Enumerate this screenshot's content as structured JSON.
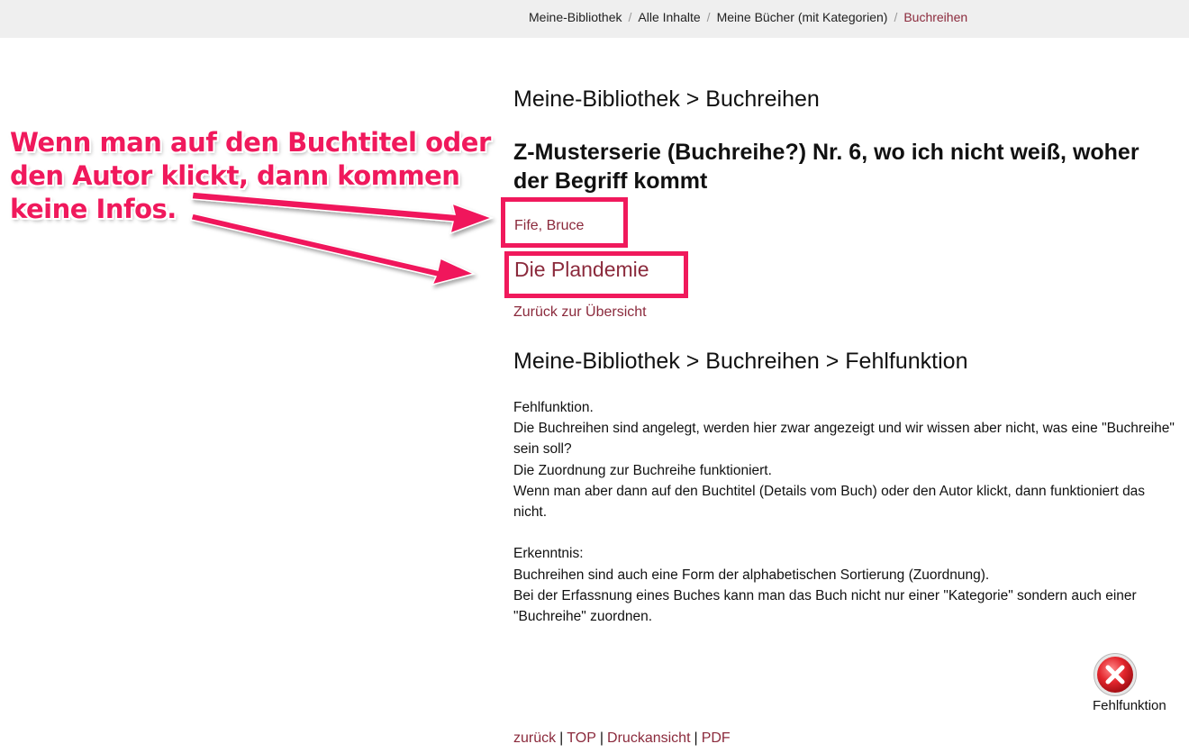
{
  "breadcrumb": {
    "items": [
      "Meine-Bibliothek",
      "Alle Inhalte",
      "Meine Bücher (mit Kategorien)"
    ],
    "current": "Buchreihen",
    "separator": "/"
  },
  "section1": {
    "heading": "Meine-Bibliothek > Buchreihen",
    "series_title": "Z-Musterserie (Buchreihe?) Nr. 6, wo ich nicht weiß, woher der Begriff kommt",
    "author_link": "Fife, Bruce",
    "book_link": "Die Plandemie",
    "back_link": "Zurück zur Übersicht"
  },
  "annotation": {
    "note_lines": [
      "Wenn man auf den Buchtitel oder",
      "den Autor klickt, dann kommen",
      "keine Infos."
    ],
    "color": "#f0195c"
  },
  "section2": {
    "heading": "Meine-Bibliothek > Buchreihen > Fehlfunktion",
    "paragraphs": [
      "Fehlfunktion.",
      "Die Buchreihen sind angelegt, werden hier zwar angezeigt und wir wissen aber nicht, was eine \"Buchreihe\" sein soll?",
      "Die Zuordnung zur Buchreihe funktioniert.",
      "Wenn man aber dann auf den Buchtitel (Details vom Buch) oder den Autor klickt, dann funktioniert das nicht.",
      "",
      "Erkenntnis:",
      "Buchreihen sind auch eine Form der alphabetischen Sortierung (Zuordnung).",
      "Bei der Erfassnung eines Buches kann man das Buch nicht nur einer \"Kategorie\" sondern auch einer \"Buchreihe\" zuordnen."
    ]
  },
  "status": {
    "icon": "error-icon",
    "label": "Fehlfunktion"
  },
  "footer": {
    "links": [
      "zurück",
      "TOP",
      "Druckansicht",
      "PDF"
    ],
    "separator": "|"
  },
  "colors": {
    "link": "#8b2a3c",
    "topbar": "#efefef",
    "highlight": "#f0195c"
  }
}
